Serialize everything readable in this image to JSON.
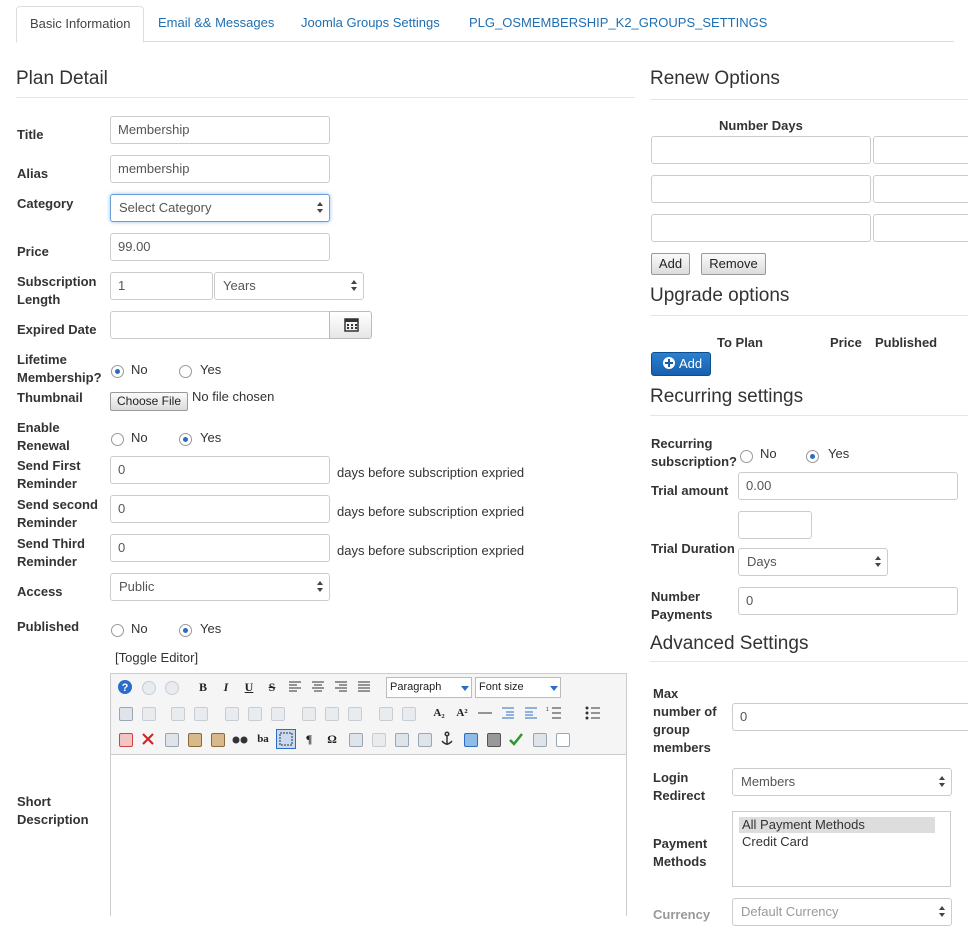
{
  "tabs": [
    {
      "label": "Basic Information",
      "active": true
    },
    {
      "label": "Email && Messages"
    },
    {
      "label": "Joomla Groups Settings"
    },
    {
      "label": "PLG_OSMEMBERSHIP_K2_GROUPS_SETTINGS"
    }
  ],
  "plan": {
    "heading": "Plan Detail",
    "title_label": "Title",
    "title_value": "Membership",
    "alias_label": "Alias",
    "alias_value": "membership",
    "category_label": "Category",
    "category_value": "Select Category",
    "price_label": "Price",
    "price_value": "99.00",
    "sub_label_1": "Subscription",
    "sub_label_2": "Length",
    "sub_value": "1",
    "sub_unit": "Years",
    "expired_label": "Expired Date",
    "lifetime_label_1": "Lifetime",
    "lifetime_label_2": "Membership?",
    "thumbnail_label": "Thumbnail",
    "choose_file": "Choose File",
    "no_file": "No file chosen",
    "renewal_label_1": "Enable",
    "renewal_label_2": "Renewal",
    "first_rem_1": "Send First",
    "first_rem_2": "Reminder",
    "first_rem_value": "0",
    "second_rem_1": "Send second",
    "second_rem_2": "Reminder",
    "second_rem_value": "0",
    "third_rem_1": "Send Third",
    "third_rem_2": "Reminder",
    "third_rem_value": "0",
    "days_text": "days before subscription expried",
    "access_label": "Access",
    "access_value": "Public",
    "published_label": "Published",
    "toggle_editor": "[Toggle Editor]",
    "short_desc_1": "Short",
    "short_desc_2": "Description",
    "no": "No",
    "yes": "Yes"
  },
  "editor": {
    "format_dropdown": "Paragraph",
    "size_dropdown": "Font size"
  },
  "renew": {
    "heading": "Renew Options",
    "col_number_days": "Number Days",
    "add_button": "Add",
    "remove_button": "Remove"
  },
  "upgrade": {
    "heading": "Upgrade options",
    "col_to_plan": "To Plan",
    "col_price": "Price",
    "col_published": "Published",
    "add_button": "Add"
  },
  "recurring": {
    "heading": "Recurring settings",
    "rec_label_1": "Recurring",
    "rec_label_2": "subscription?",
    "trial_amount_label": "Trial amount",
    "trial_amount_value": "0.00",
    "trial_duration_label": "Trial Duration",
    "trial_duration_unit": "Days",
    "number_payments_1": "Number",
    "number_payments_2": "Payments",
    "number_payments_value": "0",
    "no": "No",
    "yes": "Yes"
  },
  "advanced": {
    "heading": "Advanced Settings",
    "max_1": "Max",
    "max_2": "number of",
    "max_3": "group",
    "max_4": "members",
    "max_value": "0",
    "login_1": "Login",
    "login_2": "Redirect",
    "login_value": "Members",
    "pay_1": "Payment",
    "pay_2": "Methods",
    "pay_options": [
      "All Payment Methods",
      "Credit Card"
    ],
    "currency_label": "Currency",
    "currency_value": "Default Currency"
  }
}
